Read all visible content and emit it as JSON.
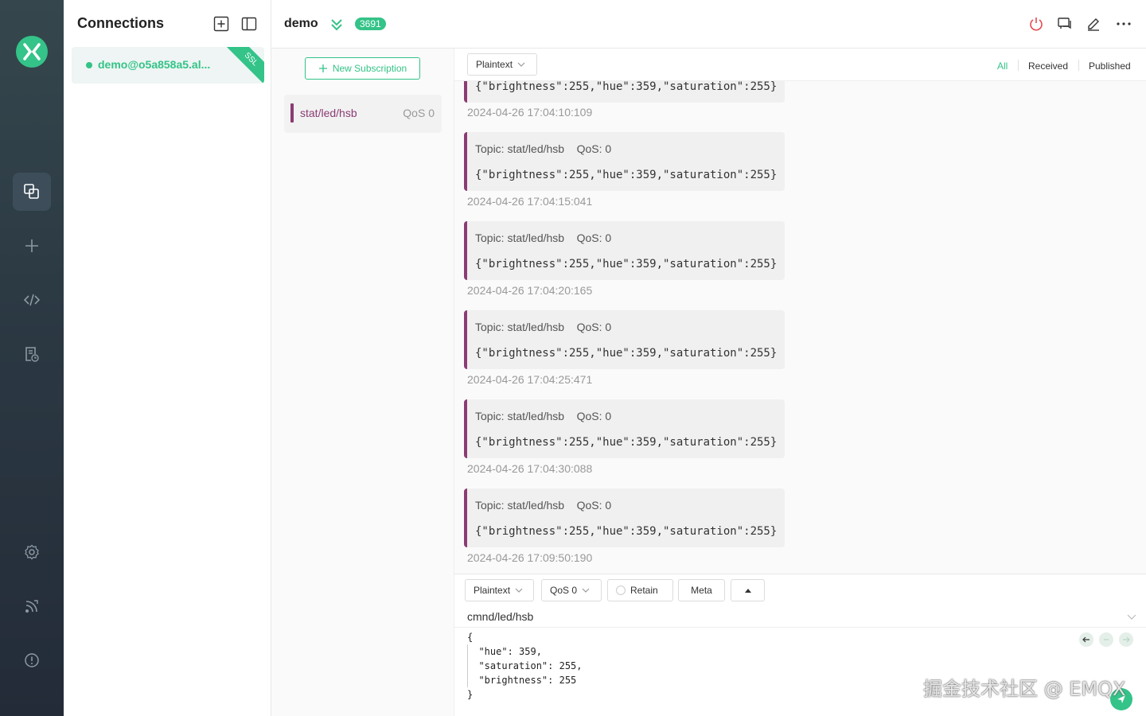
{
  "nav": {
    "items": [
      {
        "name": "connections-icon",
        "active": true
      },
      {
        "name": "add-icon"
      },
      {
        "name": "script-icon"
      },
      {
        "name": "log-icon"
      },
      {
        "name": "settings-icon"
      },
      {
        "name": "subscription-icon"
      },
      {
        "name": "about-icon"
      }
    ]
  },
  "connections": {
    "title": "Connections",
    "items": [
      {
        "name": "demo@o5a858a5.al...",
        "status": "connected",
        "ssl_label": "SSL"
      }
    ]
  },
  "header": {
    "title": "demo",
    "badge": "3691"
  },
  "subscriptions": {
    "new_label": "New Subscription",
    "items": [
      {
        "topic": "stat/led/hsb",
        "qos": "QoS 0",
        "color": "#8b3c73"
      }
    ]
  },
  "messages": {
    "format": "Plaintext",
    "filters": {
      "all": "All",
      "received": "Received",
      "published": "Published"
    },
    "partial_top": {
      "payload": "{\"brightness\":255,\"hue\":359,\"saturation\":255}",
      "time": "2024-04-26 17:04:10:109"
    },
    "items": [
      {
        "meta": "Topic: stat/led/hsb    QoS: 0",
        "payload": "{\"brightness\":255,\"hue\":359,\"saturation\":255}",
        "time": "2024-04-26 17:04:15:041"
      },
      {
        "meta": "Topic: stat/led/hsb    QoS: 0",
        "payload": "{\"brightness\":255,\"hue\":359,\"saturation\":255}",
        "time": "2024-04-26 17:04:20:165"
      },
      {
        "meta": "Topic: stat/led/hsb    QoS: 0",
        "payload": "{\"brightness\":255,\"hue\":359,\"saturation\":255}",
        "time": "2024-04-26 17:04:25:471"
      },
      {
        "meta": "Topic: stat/led/hsb    QoS: 0",
        "payload": "{\"brightness\":255,\"hue\":359,\"saturation\":255}",
        "time": "2024-04-26 17:04:30:088"
      },
      {
        "meta": "Topic: stat/led/hsb    QoS: 0",
        "payload": "{\"brightness\":255,\"hue\":359,\"saturation\":255}",
        "time": "2024-04-26 17:09:50:190"
      }
    ]
  },
  "publish": {
    "format": "Plaintext",
    "qos": "QoS 0",
    "retain": "Retain",
    "meta": "Meta",
    "topic": "cmnd/led/hsb",
    "payload": "{\n  \"hue\": 359,\n  \"saturation\": 255,\n  \"brightness\": 255\n}"
  },
  "watermark": "掘金技术社区 @ EMQX",
  "colors": {
    "accent": "#34c388",
    "topic": "#8b3c73",
    "disconnect": "#e5484d"
  }
}
